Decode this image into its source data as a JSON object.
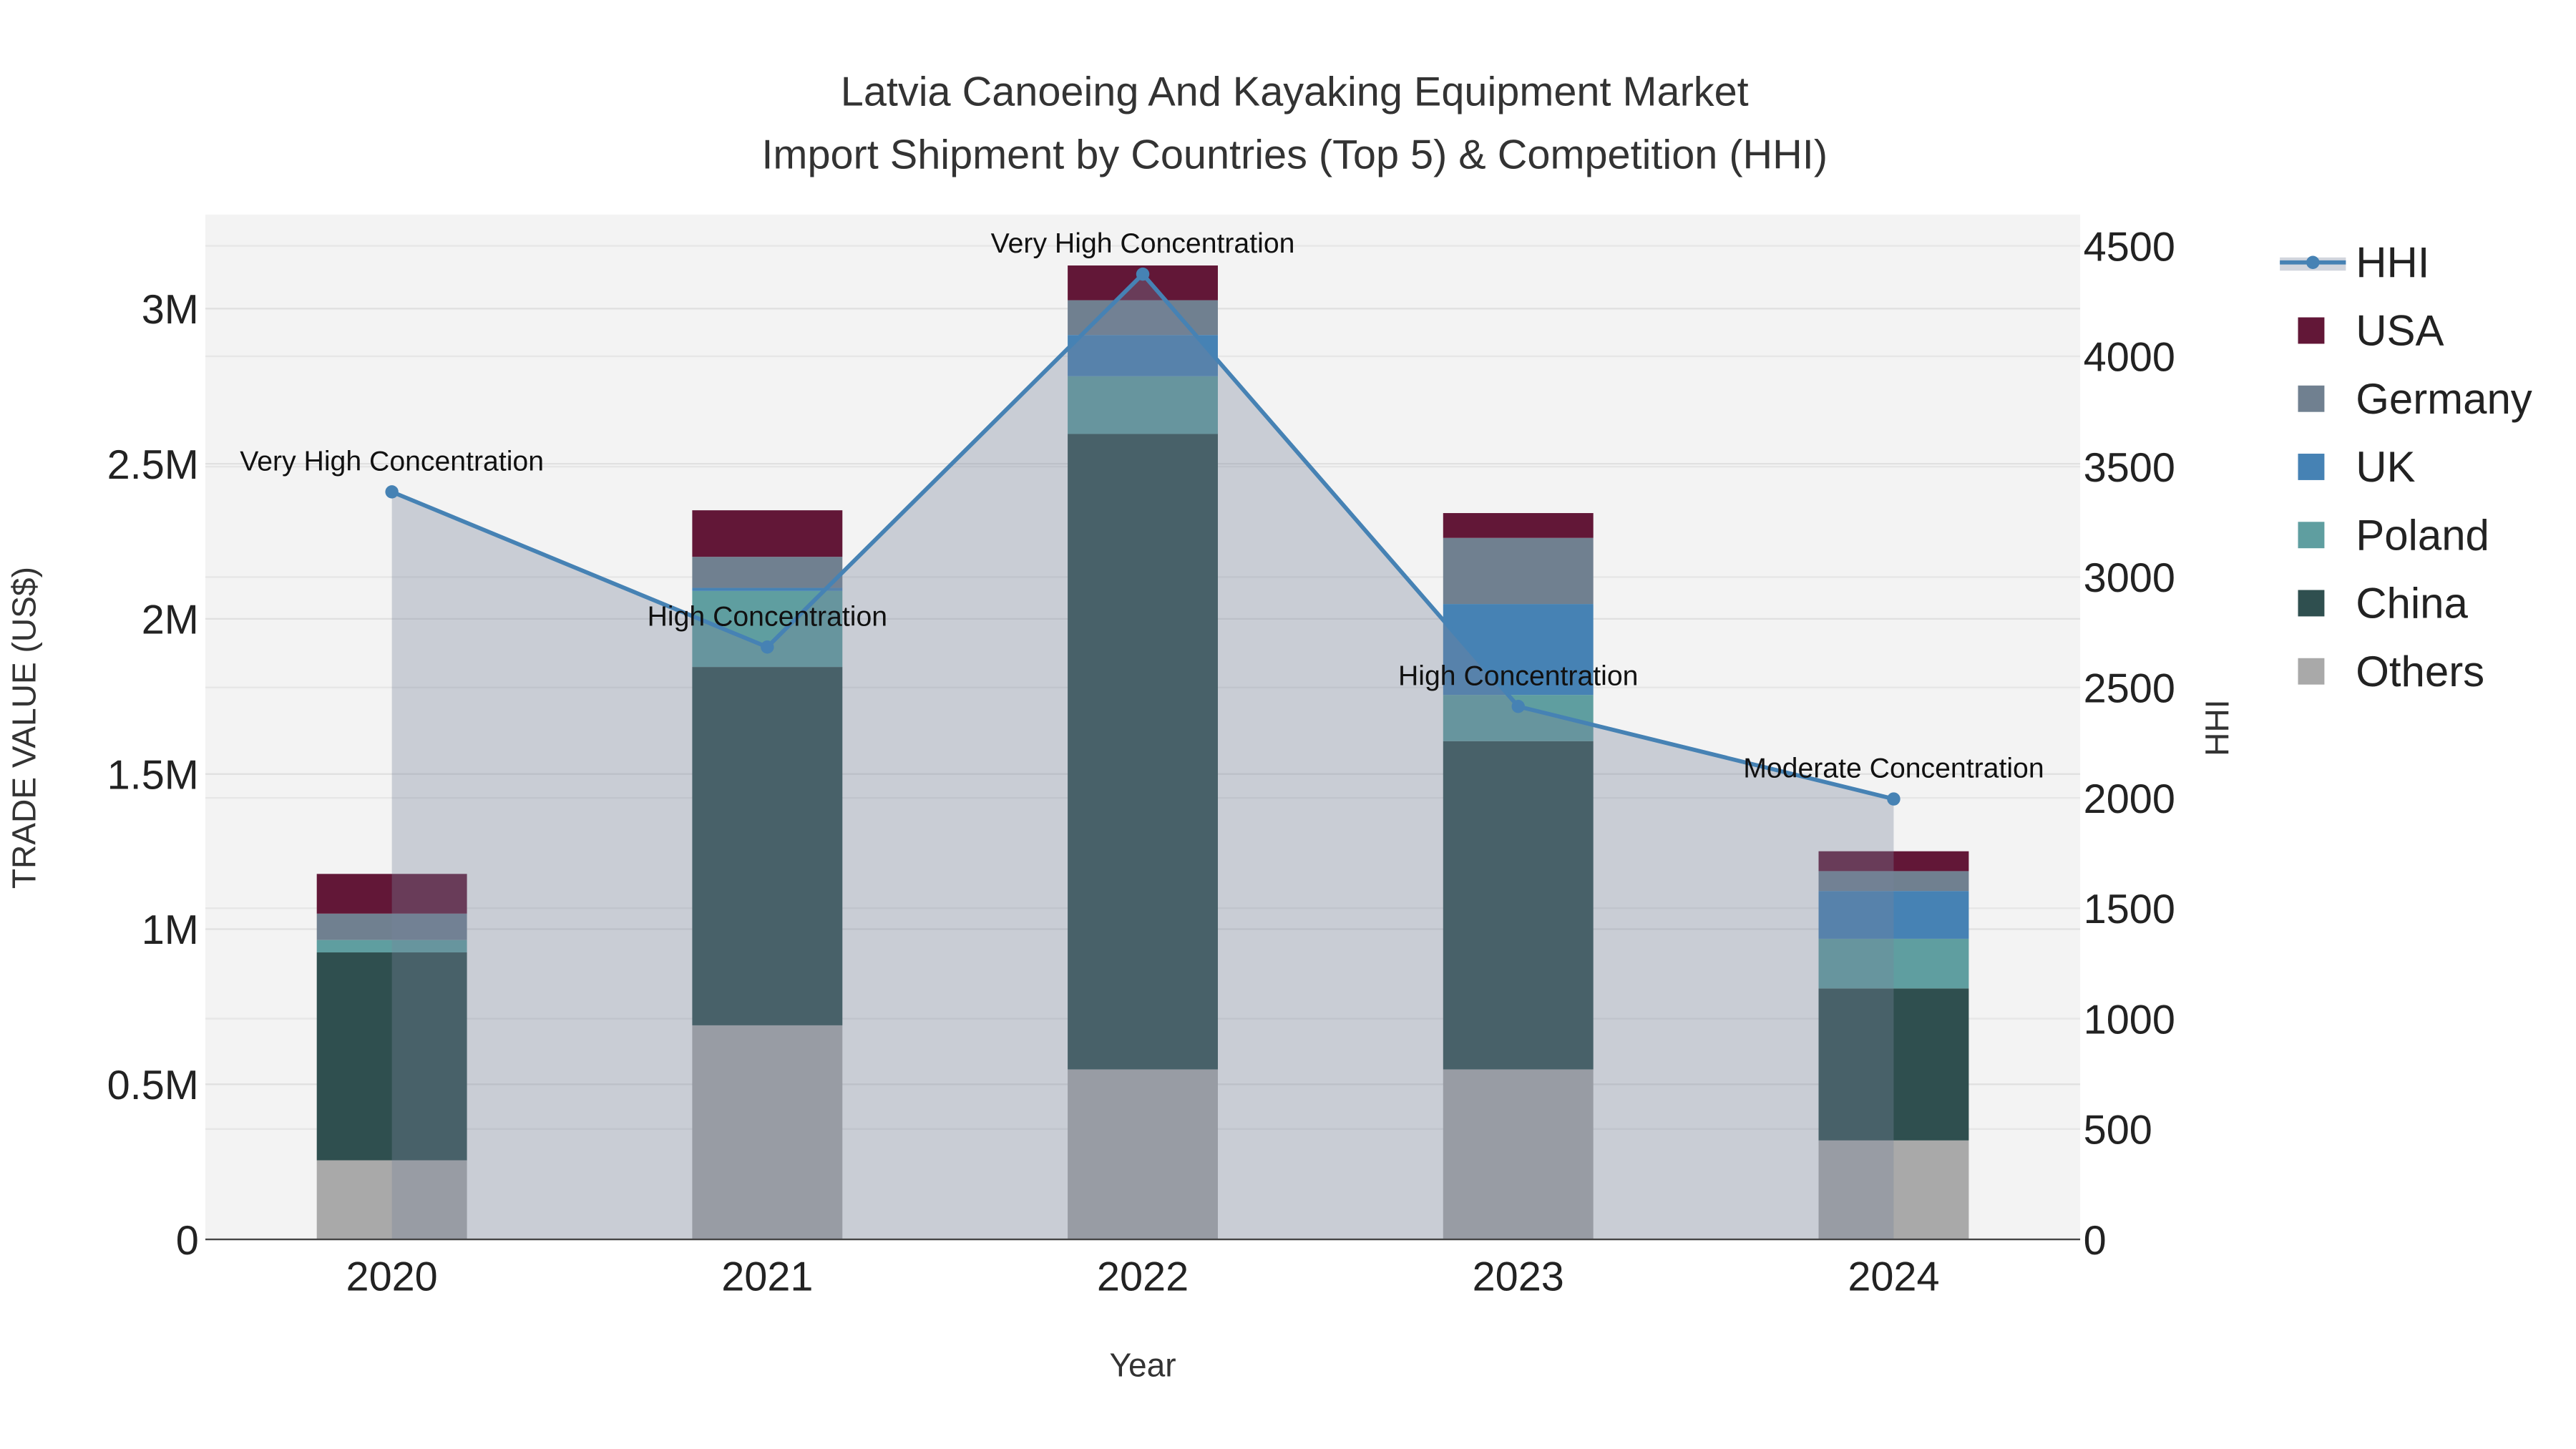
{
  "chart_data": {
    "type": "bar",
    "stacked": true,
    "title_line1": "Latvia Canoeing And Kayaking Equipment Market",
    "title_line2": "Import Shipment by Countries (Top 5) & Competition (HHI)",
    "xlabel": "Year",
    "ylabel": "TRADE VALUE (US$)",
    "y2label": "HHI",
    "ylim": [
      0,
      3.3
    ],
    "y2lim": [
      0,
      4650
    ],
    "categories": [
      "2020",
      "2021",
      "2022",
      "2023",
      "2024"
    ],
    "yticks": [
      {
        "v": 0,
        "label": "0"
      },
      {
        "v": 0.5,
        "label": "0.5M"
      },
      {
        "v": 1,
        "label": "1M"
      },
      {
        "v": 1.5,
        "label": "1.5M"
      },
      {
        "v": 2,
        "label": "2M"
      },
      {
        "v": 2.5,
        "label": "2.5M"
      },
      {
        "v": 3,
        "label": "3M"
      }
    ],
    "y2ticks": [
      {
        "v": 0,
        "label": "0"
      },
      {
        "v": 500,
        "label": "500"
      },
      {
        "v": 1000,
        "label": "1000"
      },
      {
        "v": 1500,
        "label": "1500"
      },
      {
        "v": 2000,
        "label": "2000"
      },
      {
        "v": 2500,
        "label": "2500"
      },
      {
        "v": 3000,
        "label": "3000"
      },
      {
        "v": 3500,
        "label": "3500"
      },
      {
        "v": 4000,
        "label": "4000"
      },
      {
        "v": 4500,
        "label": "4500"
      }
    ],
    "units": "million US$",
    "series": [
      {
        "name": "Others",
        "color": "#a9a9a9",
        "values": [
          0.255,
          0.69,
          0.548,
          0.548,
          0.319
        ]
      },
      {
        "name": "China",
        "color": "#2f4f4f",
        "values": [
          0.67,
          1.155,
          2.048,
          1.058,
          0.49
        ]
      },
      {
        "name": "Poland",
        "color": "#5f9ea0",
        "values": [
          0.04,
          0.245,
          0.186,
          0.149,
          0.16
        ]
      },
      {
        "name": "UK",
        "color": "#4682b4",
        "values": [
          0.0,
          0.01,
          0.133,
          0.293,
          0.154
        ]
      },
      {
        "name": "Germany",
        "color": "#708090",
        "values": [
          0.085,
          0.1,
          0.112,
          0.213,
          0.064
        ]
      },
      {
        "name": "USA",
        "color": "#621737",
        "values": [
          0.128,
          0.15,
          0.112,
          0.08,
          0.064
        ]
      }
    ],
    "hhi": {
      "name": "HHI",
      "color": "#4682b4",
      "values": [
        3386,
        2683,
        4372,
        2414,
        1995
      ],
      "annotations": [
        "Very High Concentration",
        "High Concentration",
        "Very High Concentration",
        "High Concentration",
        "Moderate Concentration"
      ]
    },
    "legend_order": [
      "HHI",
      "USA",
      "Germany",
      "UK",
      "Poland",
      "China",
      "Others"
    ],
    "legend_placement": "right",
    "grid": true
  }
}
